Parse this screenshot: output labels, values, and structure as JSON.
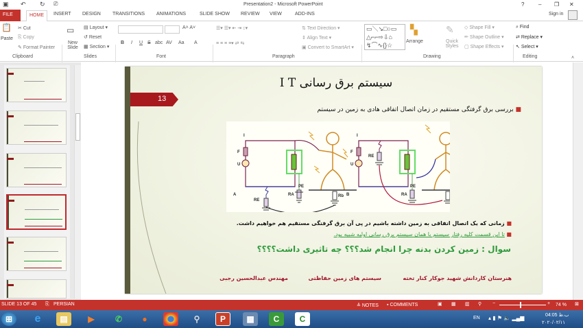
{
  "window": {
    "title": "Presentation2 - Microsoft PowerPoint",
    "help": "?",
    "minimize": "–",
    "restore": "❐",
    "close": "✕",
    "sign_in": "Sign in"
  },
  "quick_access": {
    "save": "save-icon",
    "undo": "↶",
    "redo": "↻"
  },
  "tabs": [
    "FILE",
    "HOME",
    "INSERT",
    "DESIGN",
    "TRANSITIONS",
    "ANIMATIONS",
    "SLIDE SHOW",
    "REVIEW",
    "VIEW",
    "ADD-INS"
  ],
  "ribbon": {
    "clipboard": {
      "paste": "Paste",
      "cut": "Cut",
      "copy": "Copy",
      "format_painter": "Format Painter",
      "label": "Clipboard"
    },
    "slides": {
      "new_slide": "New Slide",
      "layout": "Layout",
      "reset": "Reset",
      "section": "Section",
      "label": "Slides"
    },
    "font": {
      "label": "Font",
      "bold": "B",
      "italic": "I",
      "underline": "U",
      "strike": "S",
      "abc": "abc",
      "spacing": "AV",
      "case": "Aa",
      "color": "A"
    },
    "paragraph": {
      "label": "Paragraph",
      "text_direction": "Text Direction",
      "align_text": "Align Text",
      "convert": "Convert to SmartArt"
    },
    "drawing": {
      "label": "Drawing",
      "arrange": "Arrange",
      "quick_styles": "Quick Styles",
      "shape_fill": "Shape Fill",
      "shape_outline": "Shape Outline",
      "shape_effects": "Shape Effects"
    },
    "editing": {
      "label": "Editing",
      "find": "Find",
      "replace": "Replace",
      "select": "Select"
    }
  },
  "slide": {
    "number": "13",
    "title": "سیستم برق رسانی I T",
    "bullet1": "بررسی برق گرفتگی مستقیم در زمان اتصال اتفاقی هادی به زمین در سیستم",
    "diagram": {
      "labels": {
        "I": "I",
        "F": "F",
        "U": "U",
        "RE": "RE",
        "RA": "RA",
        "PE": "PE",
        "Rb": "Rb",
        "A": "A",
        "B": "B"
      }
    },
    "bullet2": "زمانی که یک اتصال اتفاقی به زمین داشته باشیم در پی آن برق گرفتگی مستقیم هم خواهیم داشت.",
    "bullet3": "تا این قسمت کلیه رفتار سیستم با همان سیستم برق رسانی اولیه شبیه بود.",
    "question": "سوال :  زمین کردن بدنه چرا انجام شد؟؟؟ چه تاثیری داشت؟؟؟؟",
    "footer": [
      "هنرستان کاردانش شهید جوکار کنار تخته",
      "سیستم های زمین حفاظتی",
      "مهندس عبدالحسین رجبی"
    ]
  },
  "status": {
    "slide_of": "SLIDE 13 OF 45",
    "language": "PERSIAN",
    "notes": "NOTES",
    "comments": "COMMENTS",
    "zoom": "74 %"
  },
  "taskbar": {
    "lang": "EN",
    "time": "04:05 ب.ظ",
    "date": "۲۰۲۰/۰۲/۱۱"
  },
  "colors": {
    "accent": "#c4322c",
    "green_text": "#2e9a3c",
    "footer_red": "#a0142a"
  }
}
